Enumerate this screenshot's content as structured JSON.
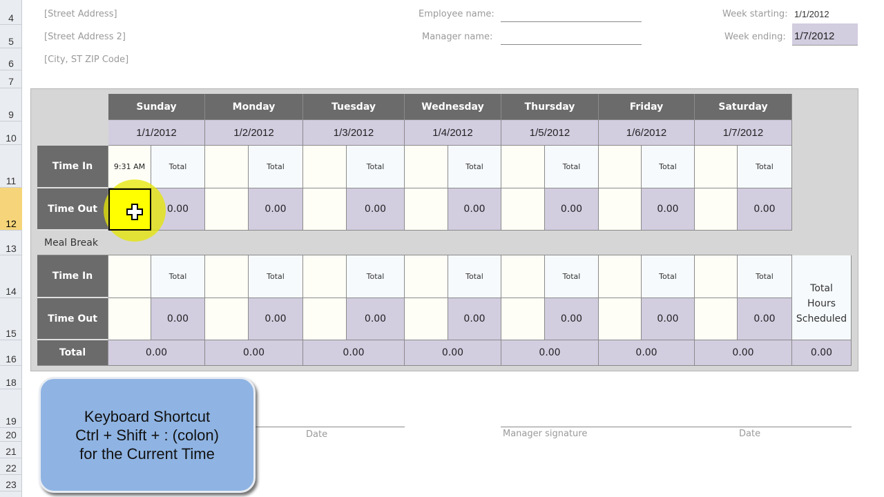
{
  "row_headers": [
    "4",
    "5",
    "6",
    "7",
    "9",
    "10",
    "11",
    "12",
    "13",
    "14",
    "15",
    "16",
    "18",
    "19",
    "20",
    "21",
    "22",
    "23"
  ],
  "active_row": "12",
  "address": {
    "street": "[Street Address]",
    "street2": "[Street Address 2]",
    "city": "[City, ST  ZIP Code]"
  },
  "employee_label": "Employee name:",
  "employee_value": "",
  "manager_label": "Manager name:",
  "manager_value": "",
  "week_starting_label": "Week starting:",
  "week_starting_value": "1/1/2012",
  "week_ending_label": "Week ending:",
  "week_ending_value": "1/7/2012",
  "days": [
    {
      "name": "Sunday",
      "date": "1/1/2012",
      "in1": "9:31 AM",
      "tot1": "Total",
      "out1": "",
      "hrs1": "0.00",
      "in2": "",
      "tot2": "Total",
      "out2": "",
      "hrs2": "0.00",
      "total": "0.00"
    },
    {
      "name": "Monday",
      "date": "1/2/2012",
      "in1": "",
      "tot1": "Total",
      "out1": "",
      "hrs1": "0.00",
      "in2": "",
      "tot2": "Total",
      "out2": "",
      "hrs2": "0.00",
      "total": "0.00"
    },
    {
      "name": "Tuesday",
      "date": "1/3/2012",
      "in1": "",
      "tot1": "Total",
      "out1": "",
      "hrs1": "0.00",
      "in2": "",
      "tot2": "Total",
      "out2": "",
      "hrs2": "0.00",
      "total": "0.00"
    },
    {
      "name": "Wednesday",
      "date": "1/4/2012",
      "in1": "",
      "tot1": "Total",
      "out1": "",
      "hrs1": "0.00",
      "in2": "",
      "tot2": "Total",
      "out2": "",
      "hrs2": "0.00",
      "total": "0.00"
    },
    {
      "name": "Thursday",
      "date": "1/5/2012",
      "in1": "",
      "tot1": "Total",
      "out1": "",
      "hrs1": "0.00",
      "in2": "",
      "tot2": "Total",
      "out2": "",
      "hrs2": "0.00",
      "total": "0.00"
    },
    {
      "name": "Friday",
      "date": "1/6/2012",
      "in1": "",
      "tot1": "Total",
      "out1": "",
      "hrs1": "0.00",
      "in2": "",
      "tot2": "Total",
      "out2": "",
      "hrs2": "0.00",
      "total": "0.00"
    },
    {
      "name": "Saturday",
      "date": "1/7/2012",
      "in1": "",
      "tot1": "Total",
      "out1": "",
      "hrs1": "0.00",
      "in2": "",
      "tot2": "Total",
      "out2": "",
      "hrs2": "0.00",
      "total": "0.00"
    }
  ],
  "labels": {
    "time_in": "Time In",
    "time_out": "Time Out",
    "meal_break": "Meal Break",
    "total": "Total",
    "total_hours_scheduled": "Total Hours Scheduled",
    "total_hours_value": "0.00"
  },
  "signature": {
    "date_label": "Date",
    "manager_signature_label": "Manager signature",
    "manager_date_label": "Date"
  },
  "callout": {
    "line1": "Keyboard Shortcut",
    "line2": "Ctrl + Shift + : (colon)",
    "line3": "for the Current Time"
  }
}
